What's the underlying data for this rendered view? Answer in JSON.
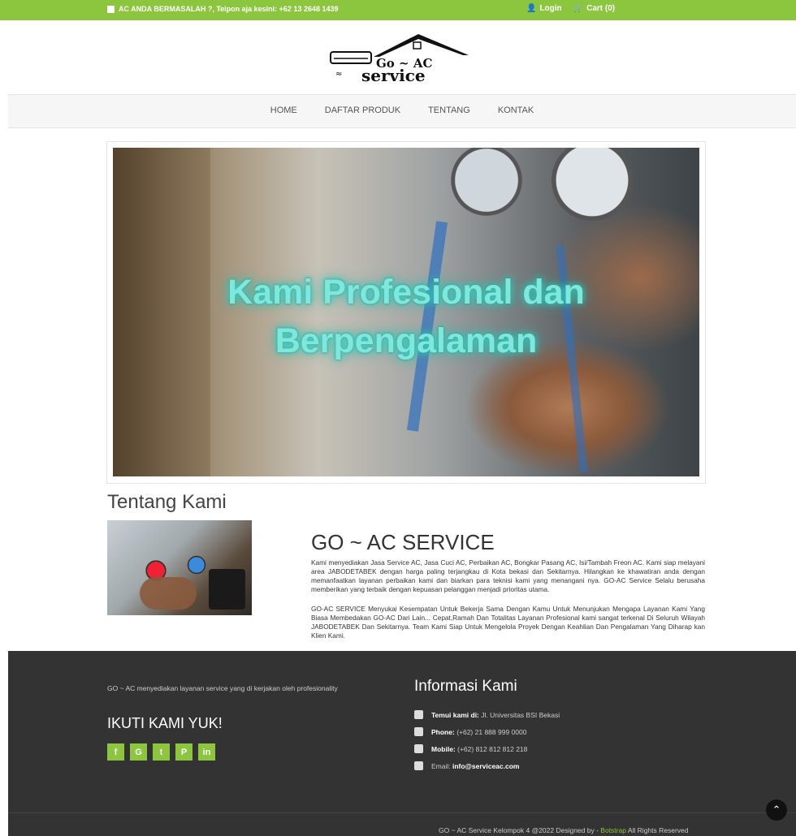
{
  "topbar": {
    "message": "AC ANDA BERMASALAH ?, Telpon aja kesini: +62 13 2648 1439",
    "login": "Login",
    "cart": "Cart (0)"
  },
  "logo": {
    "line1": "Go ~ AC",
    "line2": "service"
  },
  "nav": [
    "HOME",
    "DAFTAR PRODUK",
    "TENTANG",
    "KONTAK"
  ],
  "hero": {
    "title_line1": "Kami Profesional dan",
    "title_line2": "Berpengalaman"
  },
  "about": {
    "heading": "Tentang Kami",
    "company": "GO ~ AC SERVICE",
    "p1": "Kami menyediakan Jasa Service AC, Jasa Cuci AC, Perbaikan AC, Bongkar Pasang AC, Isi/Tambah Freon AC. Kami siap melayani area JABODETABEK dengan harga paling terjangkau di Kota bekasi dan Sekitarnya. Hilangkan ke khawatiran anda dengan memanfaatkan layanan perbaikan kami dan biarkan para teknisi kami yang menangani nya. GO-AC Service Selalu berusaha memberikan yang terbaik dengan kepuasan pelanggan menjadi prioritas utama.",
    "p2": "GO-AC SERVICE Menyukai Kesempatan Untuk Bekerja Sama Dengan Kamu Untuk Menunjukan Mengapa Layanan Kami Yang Biasa Membedakan GO-AC Dari Lain... Cepat,Ramah Dan Totalitas Layanan Profesional kami sangat terkenal Di Seluruh Wilayah JABODETABEK Dan Sekitarnya. Team Kami Siap Untuk Mengelola Proyek Dengan Keahlian Dan Pengalaman Yang Diharap kan Klien Kami."
  },
  "footer": {
    "desc": "GO ~ AC menyediakan layanan service yang di kerjakan oleh profesionality",
    "follow": "IKUTI KAMI YUK!",
    "info_heading": "Informasi Kami",
    "address_label": "Temui kami di:",
    "address": "Jl. Universitas BSI Bekasi",
    "phone_label": "Phone:",
    "phone": "(+62) 21 888 999 0000",
    "mobile_label": "Mobile:",
    "mobile": "(+62) 812 812 812 218",
    "email_label": "Email:",
    "email": "info@serviceac.com",
    "copy_pre": "GO ~ AC Service Kelompok 4 @2022 Designed by -",
    "copy_link": "Botstrap",
    "copy_post": "All Rights Reserved"
  },
  "colors": {
    "accent": "#8cc63f",
    "footer_bg": "#333333",
    "hero_text": "#7fe7dc"
  },
  "icons": [
    "phone-square-icon",
    "user-icon",
    "cart-icon",
    "facebook-icon",
    "google-icon",
    "twitter-icon",
    "pinterest-icon",
    "linkedin-icon",
    "map-marker-icon",
    "phone-icon",
    "mobile-icon",
    "envelope-icon",
    "chevron-up-icon"
  ]
}
